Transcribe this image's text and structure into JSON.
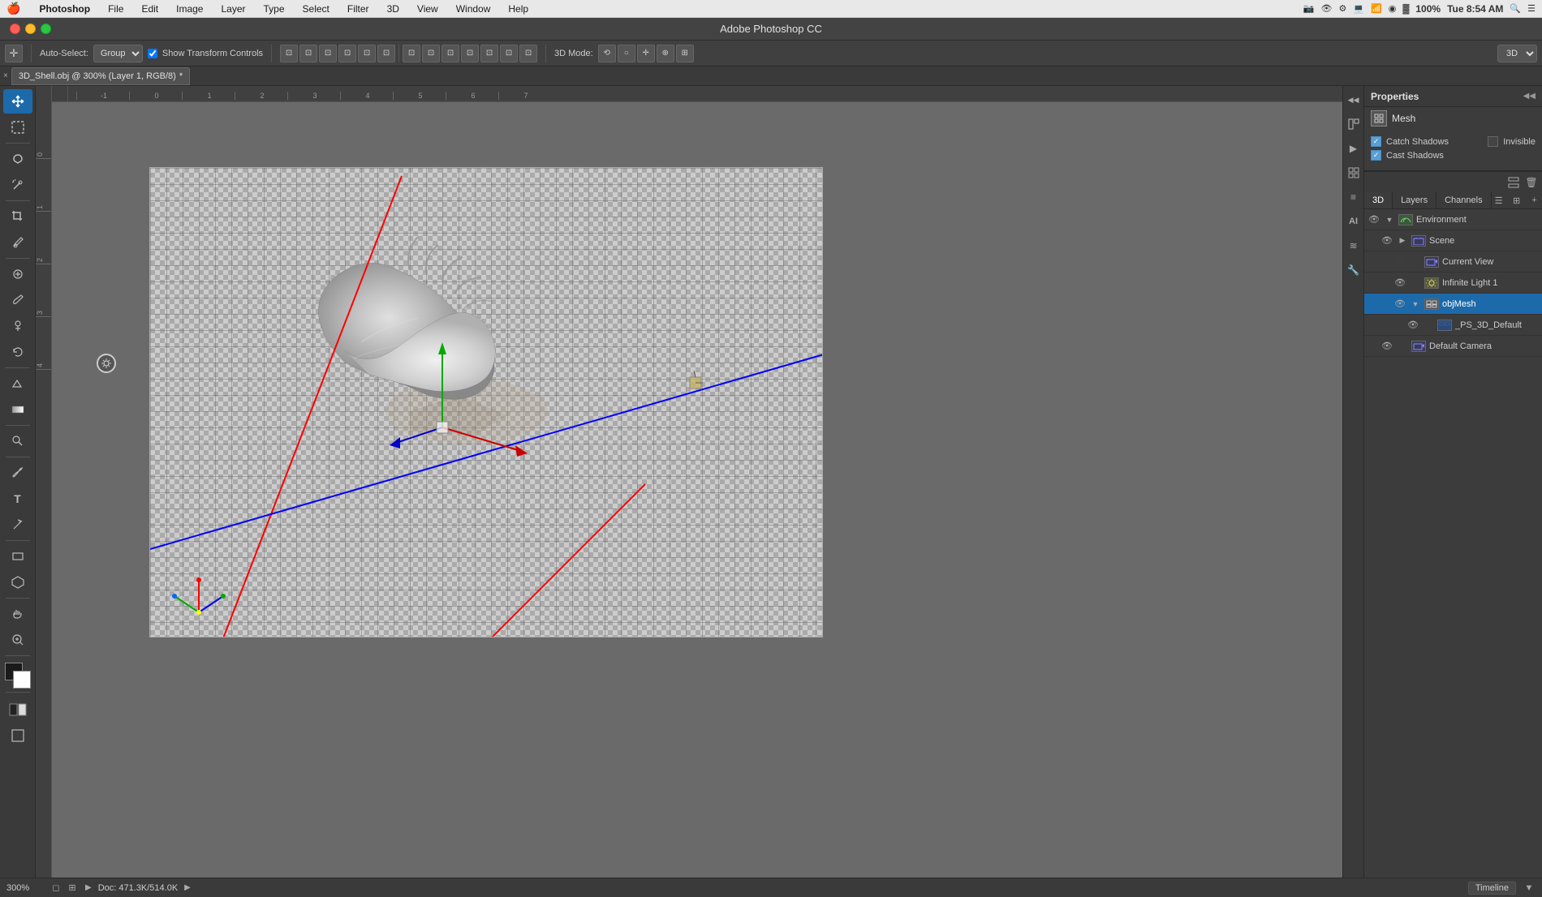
{
  "app": {
    "name": "Photoshop",
    "title": "Adobe Photoshop CC"
  },
  "menubar": {
    "apple": "🍎",
    "items": [
      "Photoshop",
      "File",
      "Edit",
      "Image",
      "Layer",
      "Type",
      "Select",
      "Filter",
      "3D",
      "View",
      "Window",
      "Help"
    ],
    "right_icons": [
      "📷",
      "👁",
      "⚙",
      "💻",
      "📶",
      "🔵",
      "⬛",
      "100%",
      "Tue 8:54 AM",
      "🔍",
      "☰"
    ]
  },
  "title_bar": {
    "title": "Adobe Photoshop CC"
  },
  "options_bar": {
    "tool_label": "Auto-Select:",
    "tool_value": "Group",
    "show_transform": "Show Transform Controls",
    "mode_label": "3D Mode:",
    "mode_value": "3D",
    "transform_icons": [
      "⊡",
      "⊞",
      "⊟",
      "⊠",
      "⊡",
      "⊢",
      "⊣",
      "⊤",
      "⊥",
      "⊦",
      "⊧",
      "⊨"
    ]
  },
  "doc_tab": {
    "close_icon": "×",
    "name": "3D_Shell.obj @ 300% (Layer 1, RGB/8)",
    "modified": "*"
  },
  "canvas": {
    "ruler_marks_h": [
      "-1",
      "0",
      "1",
      "2",
      "3",
      "4",
      "5",
      "6",
      "7"
    ],
    "ruler_marks_v": [
      "0",
      "1",
      "2",
      "3",
      "4"
    ],
    "zoom": "300%",
    "doc_info": "Doc: 471.3K/514.0K",
    "origin_icon": "☀"
  },
  "properties_panel": {
    "title": "Properties",
    "collapse_icon": "◀◀",
    "mesh_icon": "⊞",
    "mesh_label": "Mesh",
    "catch_shadows_label": "Catch Shadows",
    "cast_shadows_label": "Cast Shadows",
    "invisible_label": "Invisible",
    "catch_shadows_checked": true,
    "cast_shadows_checked": true,
    "invisible_checked": false
  },
  "right_icons": {
    "icons": [
      "⊞",
      "▶",
      "⬜",
      "Ⅱ",
      "≡",
      "AI",
      "≋",
      "🔧"
    ]
  },
  "panel_tabs": {
    "tabs": [
      "3D",
      "Layers",
      "Channels"
    ],
    "active": "3D",
    "action_icons": [
      "⊞",
      "🗑",
      "⊕",
      "💡"
    ]
  },
  "layers": [
    {
      "id": "environment",
      "indent": 0,
      "eye": true,
      "expand": true,
      "icon_type": "environment",
      "icon": "🌿",
      "name": "Environment"
    },
    {
      "id": "scene",
      "indent": 1,
      "eye": true,
      "expand": false,
      "icon_type": "scene",
      "icon": "🎬",
      "name": "Scene"
    },
    {
      "id": "current_view",
      "indent": 2,
      "eye": false,
      "expand": false,
      "icon_type": "camera",
      "icon": "📷",
      "name": "Current View"
    },
    {
      "id": "infinite_light_1",
      "indent": 2,
      "eye": true,
      "expand": false,
      "icon_type": "light",
      "icon": "💡",
      "name": "Infinite Light 1"
    },
    {
      "id": "obj_mesh",
      "indent": 2,
      "eye": true,
      "expand": true,
      "icon_type": "mesh",
      "icon": "⊞",
      "name": "objMesh",
      "selected": true
    },
    {
      "id": "ps_3d_default",
      "indent": 3,
      "eye": true,
      "expand": false,
      "icon_type": "blue",
      "icon": "⬜",
      "name": "_PS_3D_Default"
    },
    {
      "id": "default_camera",
      "indent": 1,
      "eye": true,
      "expand": false,
      "icon_type": "camera",
      "icon": "📷",
      "name": "Default Camera"
    }
  ],
  "status_bar": {
    "zoom": "300%",
    "doc_info": "Doc: 471.3K/514.0K",
    "arrow": "▶",
    "timeline_label": "Timeline"
  }
}
